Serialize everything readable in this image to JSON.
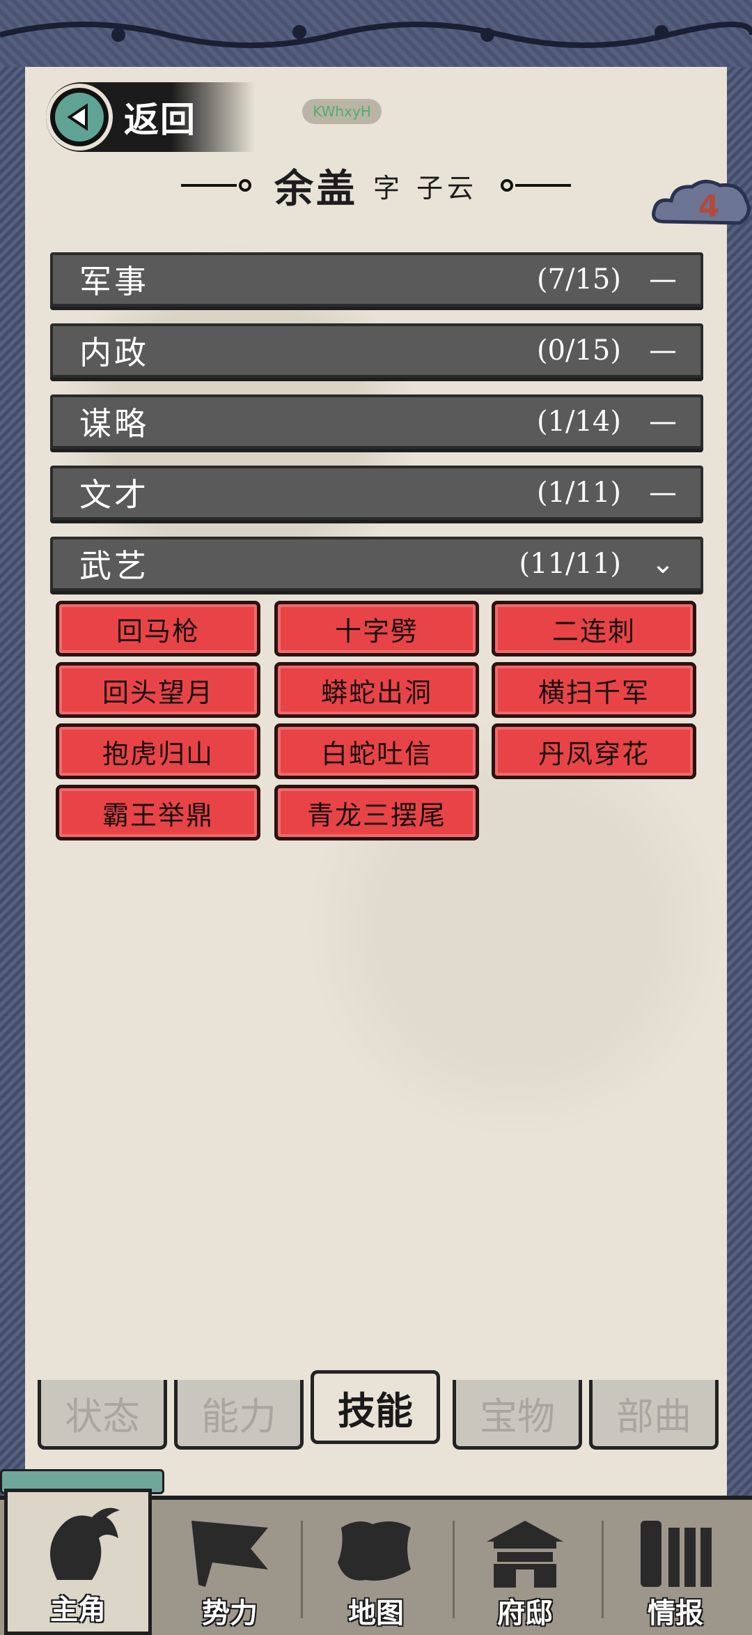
{
  "header": {
    "back_label": "返回",
    "badge_text": "KWhxyH",
    "hero_name": "余盖",
    "hero_courtesy": "字 子云",
    "cloud_count": "4"
  },
  "categories": [
    {
      "name": "军事",
      "count": "(7/15)",
      "icon": "—"
    },
    {
      "name": "内政",
      "count": "(0/15)",
      "icon": "—"
    },
    {
      "name": "谋略",
      "count": "(1/14)",
      "icon": "—"
    },
    {
      "name": "文才",
      "count": "(1/11)",
      "icon": "—"
    },
    {
      "name": "武艺",
      "count": "(11/11)",
      "icon": "⌄"
    }
  ],
  "skills": [
    "回马枪",
    "十字劈",
    "二连刺",
    "回头望月",
    "蟒蛇出洞",
    "横扫千军",
    "抱虎归山",
    "白蛇吐信",
    "丹凤穿花",
    "霸王举鼎",
    "青龙三摆尾"
  ],
  "tabs": [
    "状态",
    "能力",
    "技能",
    "宝物",
    "部曲"
  ],
  "active_tab": "技能",
  "bottom_nav": [
    "主角",
    "势力",
    "地图",
    "府邸",
    "情报"
  ],
  "colors": {
    "skill_red": "#e84447",
    "category_gray": "#5a5a5a",
    "parchment": "#e8e3d6",
    "border_blue": "#4a5472"
  }
}
